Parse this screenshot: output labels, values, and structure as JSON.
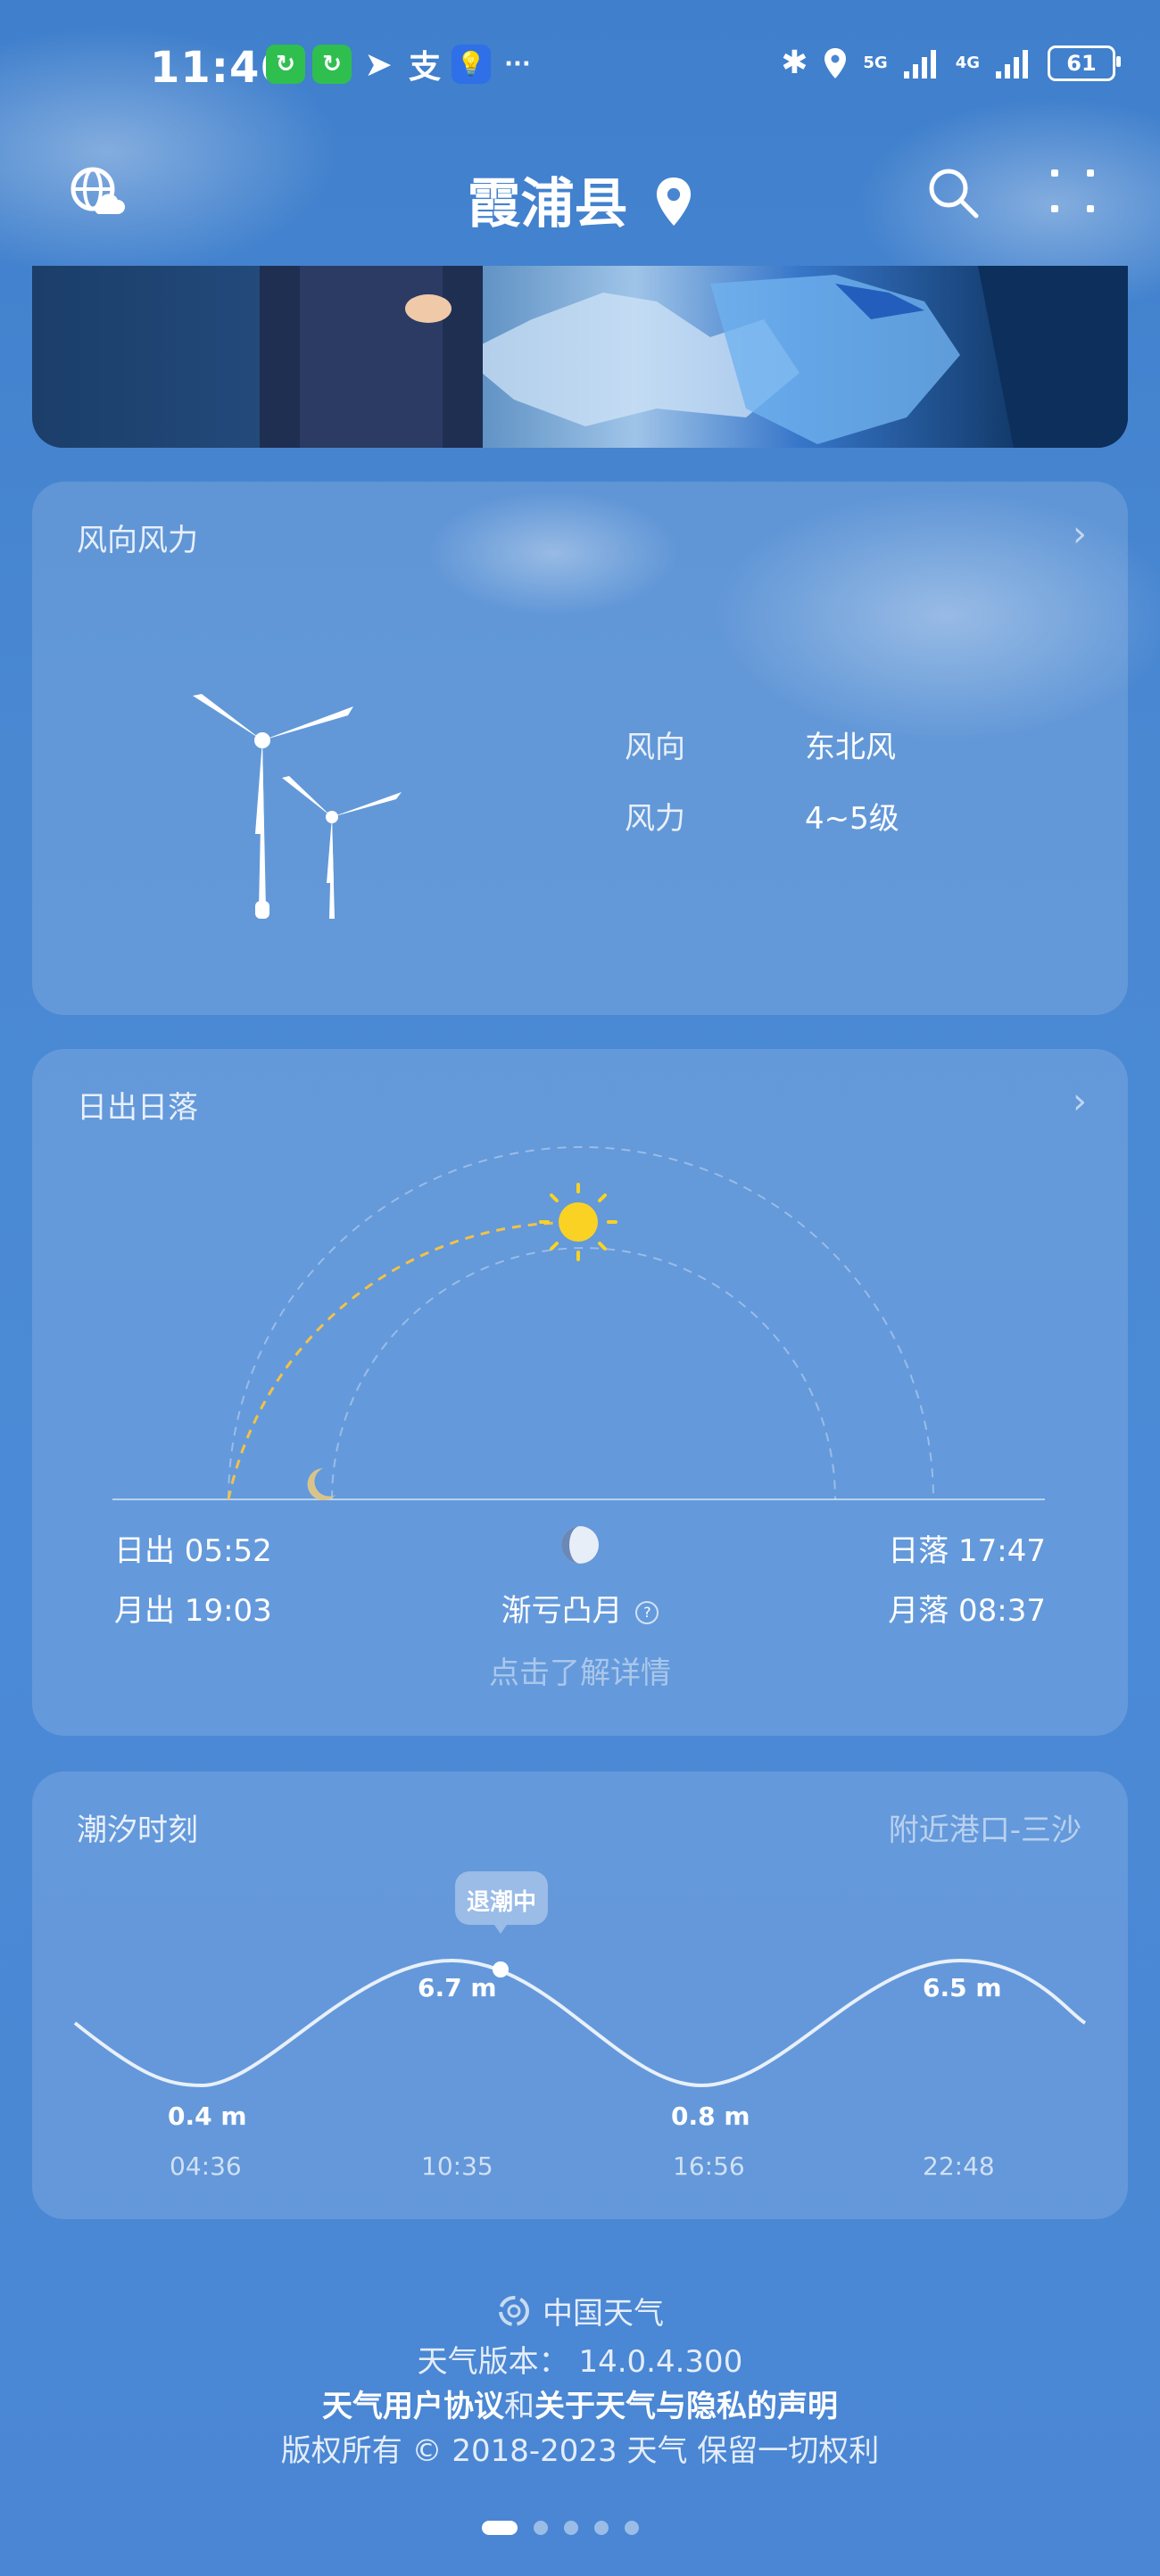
{
  "status_bar": {
    "time": "11:46",
    "app_icons": [
      {
        "name": "app-notify-icon-1",
        "color": "#2fbf4f"
      },
      {
        "name": "app-notify-icon-2",
        "color": "#2fbf4f"
      },
      {
        "name": "telegram-icon",
        "color": "#ffffff"
      },
      {
        "name": "alipay-icon",
        "color": "#ffffff"
      },
      {
        "name": "bulb-app-icon",
        "color": "#2f6fe8"
      }
    ],
    "more": "···",
    "network_1": "5G",
    "network_2": "4G",
    "battery": "61"
  },
  "header": {
    "city": "霞浦县"
  },
  "wind_card": {
    "title": "风向风力",
    "direction_label": "风向",
    "direction_value": "东北风",
    "force_label": "风力",
    "force_value": "4~5级"
  },
  "sun_card": {
    "title": "日出日落",
    "sunrise": "日出 05:52",
    "sunset": "日落 17:47",
    "moonrise": "月出 19:03",
    "moonset": "月落 08:37",
    "moon_phase": "渐亏凸月",
    "detail_link": "点击了解详情"
  },
  "tide_card": {
    "title": "潮汐时刻",
    "port": "附近港口-三沙",
    "status_badge": "退潮中",
    "points": [
      {
        "height": "0.4 m",
        "time": "04:36"
      },
      {
        "height": "6.7 m",
        "time": "10:35"
      },
      {
        "height": "0.8 m",
        "time": "16:56"
      },
      {
        "height": "6.5 m",
        "time": "22:48"
      }
    ]
  },
  "footer": {
    "brand": "中国天气",
    "version": "天气版本： 14.0.4.300",
    "agreement_link": "天气用户协议",
    "and": "和",
    "privacy_link": "关于天气与隐私的声明",
    "copyright": "版权所有 © 2018-2023 天气 保留一切权利"
  },
  "page_dots": {
    "count": 5,
    "active": 0
  }
}
